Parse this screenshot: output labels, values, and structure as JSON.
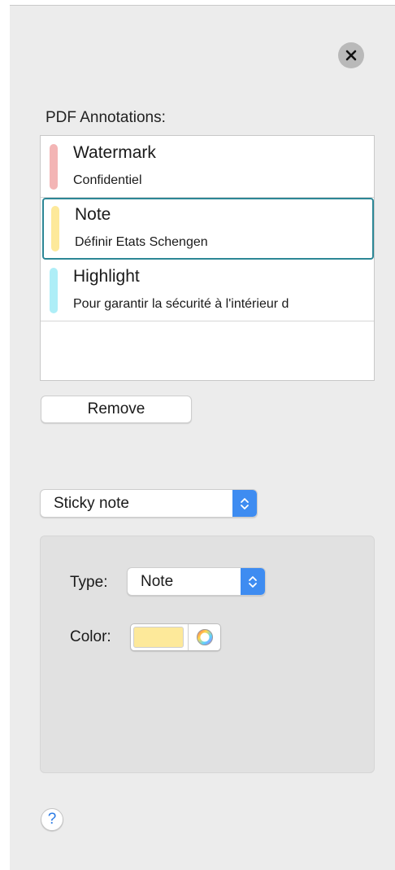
{
  "close_icon": "close-x-icon",
  "annotations": {
    "label": "PDF Annotations:",
    "items": [
      {
        "title": "Watermark",
        "subtitle": "Confidentiel",
        "color": "#f3b5b5"
      },
      {
        "title": "Note",
        "subtitle": "Définir Etats Schengen",
        "color": "#fde99a",
        "selected": true
      },
      {
        "title": "Highlight",
        "subtitle": "Pour garantir la sécurité à l'intérieur d",
        "color": "#aeeef7"
      }
    ]
  },
  "remove_button": {
    "label": "Remove"
  },
  "annotation_kind": {
    "selected": "Sticky note"
  },
  "properties": {
    "type_label": "Type:",
    "type_value": "Note",
    "color_label": "Color:",
    "color_value": "#fde99a"
  },
  "help": {
    "label": "?"
  },
  "colors": {
    "panel_bg": "#ececec",
    "selection_border": "#2d8796",
    "accent_blue": "#3e8cf1"
  }
}
